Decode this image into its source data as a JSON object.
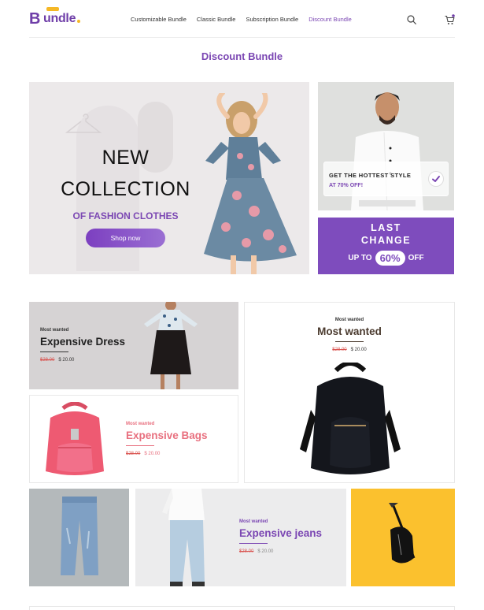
{
  "brand": {
    "logo_text": "undle",
    "logo_initial": "B"
  },
  "nav": {
    "items": [
      "Customizable Bundle",
      "Classic Bundle",
      "Subscription Bundle",
      "Discount Bundle"
    ],
    "active_index": 3
  },
  "icons": {
    "search": "search-icon",
    "cart": "cart-icon"
  },
  "colors": {
    "accent": "#7b47b3",
    "promo_bg": "#7e4cbd",
    "price_old": "#d9534f",
    "bag_pink": "#e8707f",
    "sling_bg": "#fbc12e"
  },
  "page_title": "Discount Bundle",
  "hero": {
    "line1": "NEW",
    "line2": "COLLECTION",
    "subtitle": "OF FASHION CLOTHES",
    "button": "Shop now"
  },
  "promo_card": {
    "title": "GET THE HOTTEST STYLE",
    "subtitle": "AT 70% OFF!"
  },
  "promo_banner": {
    "line1": "LAST",
    "line2": "CHANGE",
    "prefix": "UP TO",
    "percent": "60%",
    "suffix": "OFF"
  },
  "products": [
    {
      "kicker": "Most wanted",
      "title": "Expensive Dress",
      "old_price": "$28.00",
      "price": "$ 20.00"
    },
    {
      "kicker": "Most wanted",
      "title": "Most wanted",
      "old_price": "$28.00",
      "price": "$ 20.00"
    },
    {
      "kicker": "Most wanted",
      "title": "Expensive Bags",
      "old_price": "$28.00",
      "price": "$ 20.00"
    },
    {
      "kicker": "Most wanted",
      "title": "Expensive jeans",
      "old_price": "$28.00",
      "price": "$ 20.00"
    }
  ]
}
